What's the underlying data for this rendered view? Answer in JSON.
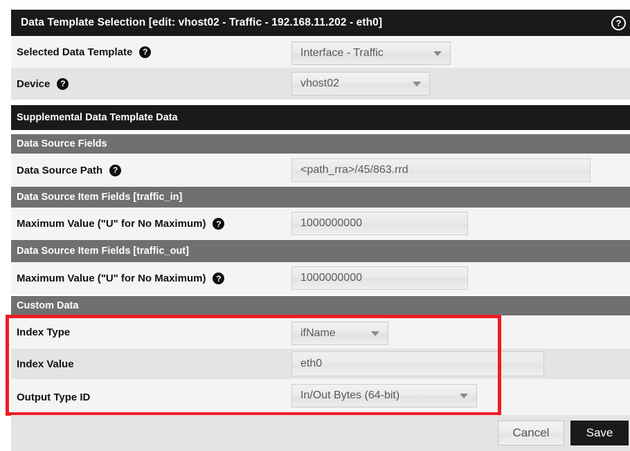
{
  "window": {
    "title": "Data Template Selection [edit: vhost02 - Traffic - 192.168.11.202 - eth0]",
    "help_icon": "question-mark-circle-icon",
    "help_glyph": "?"
  },
  "colors": {
    "header_black": "#1a1a1a",
    "section_gray": "#707070",
    "row_light": "#f4f4f4",
    "row_dark": "#e4e4e4",
    "highlight_red": "#ed1c24",
    "field_text": "#5a5a5a"
  },
  "form": {
    "selected_data_template": {
      "label": "Selected Data Template",
      "help_glyph": "?",
      "value": "Interface - Traffic"
    },
    "device": {
      "label": "Device",
      "help_glyph": "?",
      "value": "vhost02"
    }
  },
  "sections": {
    "supplemental": "Supplemental Data Template Data",
    "data_source_fields": "Data Source Fields",
    "traffic_in": "Data Source Item Fields [traffic_in]",
    "traffic_out": "Data Source Item Fields [traffic_out]",
    "custom_data": "Custom Data"
  },
  "fields": {
    "data_source_path": {
      "label": "Data Source Path",
      "help_glyph": "?",
      "value": "<path_rra>/45/863.rrd"
    },
    "max_value_in": {
      "label": "Maximum Value (\"U\" for No Maximum)",
      "help_glyph": "?",
      "value": "1000000000"
    },
    "max_value_out": {
      "label": "Maximum Value (\"U\" for No Maximum)",
      "help_glyph": "?",
      "value": "1000000000"
    },
    "index_type": {
      "label": "Index Type",
      "value": "ifName"
    },
    "index_value": {
      "label": "Index Value",
      "value": "eth0"
    },
    "output_type_id": {
      "label": "Output Type ID",
      "value": "In/Out Bytes (64-bit)"
    }
  },
  "footer": {
    "cancel_label": "Cancel",
    "save_label": "Save"
  }
}
